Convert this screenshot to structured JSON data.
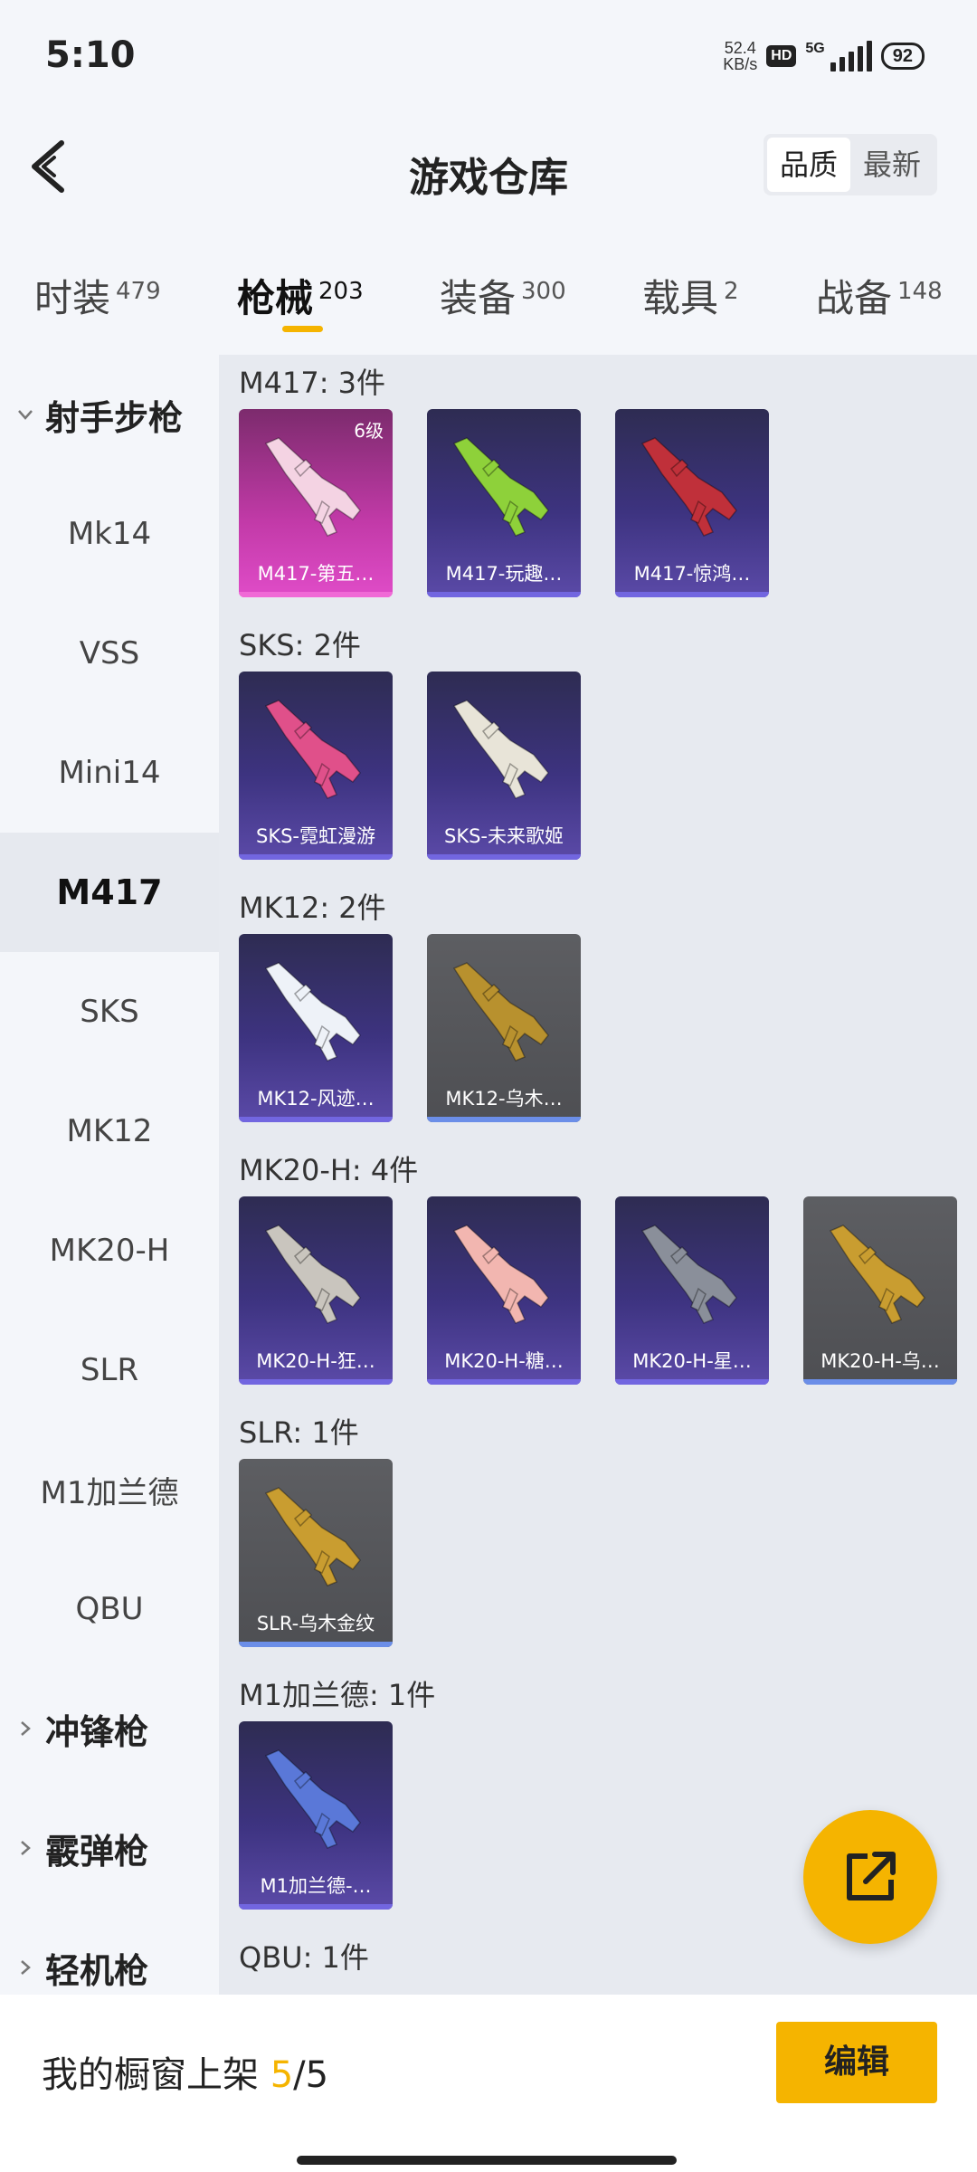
{
  "status": {
    "time": "5:10",
    "speed_value": "52.4",
    "speed_unit": "KB/s",
    "hd": "HD",
    "network": "5G",
    "battery": "92"
  },
  "header": {
    "title": "游戏仓库",
    "sort_options": [
      "品质",
      "最新"
    ],
    "active_sort": "品质"
  },
  "tabs": [
    {
      "label": "时装",
      "count": "479"
    },
    {
      "label": "枪械",
      "count": "203"
    },
    {
      "label": "装备",
      "count": "300"
    },
    {
      "label": "载具",
      "count": "2"
    },
    {
      "label": "战备",
      "count": "148"
    }
  ],
  "active_tab": "枪械",
  "sidebar": {
    "category_open": "射手步枪",
    "items": [
      "Mk14",
      "VSS",
      "Mini14",
      "M417",
      "SKS",
      "MK12",
      "MK20-H",
      "SLR",
      "M1加兰德",
      "QBU"
    ],
    "active_item": "M417",
    "categories_collapsed": [
      "冲锋枪",
      "霰弹枪",
      "轻机枪"
    ]
  },
  "groups": [
    {
      "title": "M417: 3件",
      "items": [
        {
          "name": "M417-第五…",
          "badge": "6级",
          "style": "pink",
          "gun_color": "#f4d3e3"
        },
        {
          "name": "M417-玩趣…",
          "badge": "",
          "style": "purple",
          "gun_color": "#8ed13a"
        },
        {
          "name": "M417-惊鸿…",
          "badge": "",
          "style": "purple",
          "gun_color": "#c0303a"
        }
      ]
    },
    {
      "title": "SKS: 2件",
      "items": [
        {
          "name": "SKS-霓虹漫游",
          "badge": "",
          "style": "purple",
          "gun_color": "#e0508a"
        },
        {
          "name": "SKS-未来歌姬",
          "badge": "",
          "style": "purple",
          "gun_color": "#e8e4d8"
        }
      ]
    },
    {
      "title": "MK12: 2件",
      "items": [
        {
          "name": "MK12-风迹…",
          "badge": "",
          "style": "purple",
          "gun_color": "#eef2f8"
        },
        {
          "name": "MK12-乌木…",
          "badge": "",
          "style": "gray",
          "gun_color": "#b8912e"
        }
      ]
    },
    {
      "title": "MK20-H: 4件",
      "items": [
        {
          "name": "MK20-H-狂…",
          "badge": "",
          "style": "purple",
          "gun_color": "#c9c5be"
        },
        {
          "name": "MK20-H-糖…",
          "badge": "",
          "style": "purple",
          "gun_color": "#f2b6b0"
        },
        {
          "name": "MK20-H-星…",
          "badge": "",
          "style": "purple",
          "gun_color": "#8a8f9a"
        },
        {
          "name": "MK20-H-乌…",
          "badge": "",
          "style": "gray",
          "gun_color": "#c99d30"
        }
      ]
    },
    {
      "title": "SLR: 1件",
      "items": [
        {
          "name": "SLR-乌木金纹",
          "badge": "",
          "style": "gray",
          "gun_color": "#c99d30"
        }
      ]
    },
    {
      "title": "M1加兰德: 1件",
      "items": [
        {
          "name": "M1加兰德-…",
          "badge": "",
          "style": "purple",
          "gun_color": "#5a78d8"
        }
      ]
    },
    {
      "title": "QBU: 1件",
      "items": []
    }
  ],
  "bottom": {
    "label": "我的橱窗上架",
    "current": "5",
    "separator": "/",
    "total": "5",
    "edit_label": "编辑"
  }
}
